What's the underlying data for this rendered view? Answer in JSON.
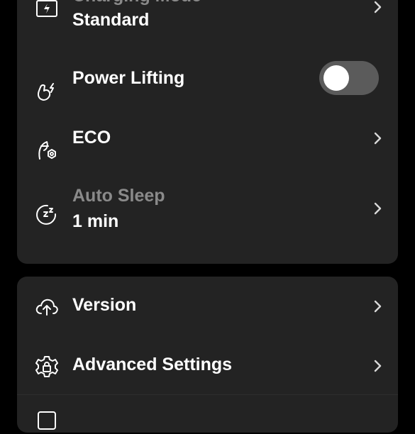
{
  "settings_group_1": {
    "charging_mode": {
      "title": "Charging Mode",
      "value": "Standard"
    },
    "power_lifting": {
      "label": "Power Lifting",
      "enabled": false
    },
    "eco": {
      "label": "ECO"
    },
    "auto_sleep": {
      "title": "Auto Sleep",
      "value": "1 min"
    }
  },
  "settings_group_2": {
    "version": {
      "label": "Version"
    },
    "advanced_settings": {
      "label": "Advanced Settings"
    }
  },
  "colors": {
    "background": "#000000",
    "card": "#232323",
    "text_primary": "#ffffff",
    "text_secondary": "#8a8a8a",
    "toggle_off": "#5b5b5b"
  }
}
